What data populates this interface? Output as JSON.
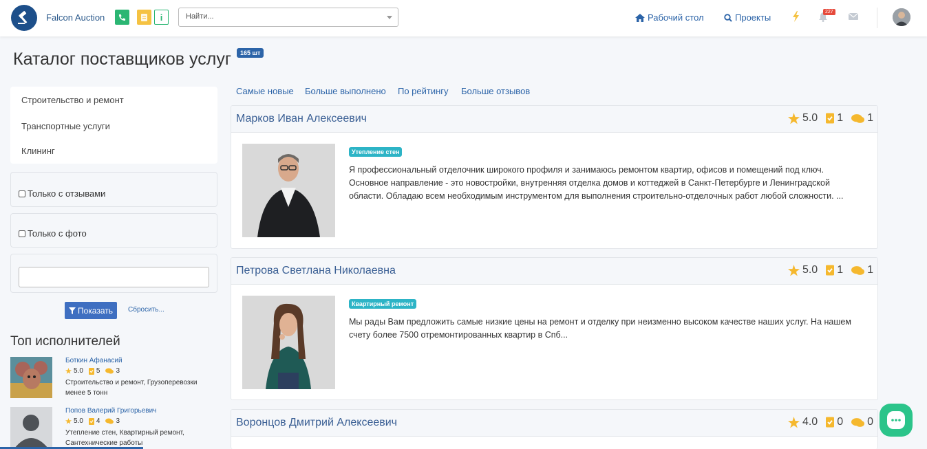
{
  "header": {
    "brand": "Falcon Auction",
    "search_placeholder": "Найти...",
    "nav": {
      "desktop": "Рабочий стол",
      "projects": "Проекты"
    },
    "notifications_count": "227",
    "colors": {
      "primary": "#2c64a8",
      "phone": "#2bb673",
      "note": "#f5c242"
    }
  },
  "page": {
    "title": "Каталог поставщиков услуг",
    "count_badge": "165 шт"
  },
  "sidebar": {
    "categories": [
      "Строительство и ремонт",
      "Транспортные услуги",
      "Клининг"
    ],
    "filter_reviews": "Только с отзывами",
    "filter_photo": "Только с фото",
    "show_button": "Показать",
    "reset_link": "Сбросить...",
    "top_title": "Топ исполнителей",
    "top": [
      {
        "name": "Боткин Афанасий",
        "rating": "5.0",
        "done": "5",
        "reviews": "3",
        "spec": "Строительство и ремонт, Грузоперевозки менее 5 тонн"
      },
      {
        "name": "Попов Валерий Григорьевич",
        "rating": "5.0",
        "done": "4",
        "reviews": "3",
        "spec": "Утепление стен, Квартирный ремонт, Сантехнические работы"
      }
    ]
  },
  "sort": [
    "Самые новые",
    "Больше выполнено",
    "По рейтингу",
    "Больше отзывов"
  ],
  "cards": [
    {
      "name": "Марков Иван Алексеевич",
      "rating": "5.0",
      "done": "1",
      "reviews": "1",
      "tag": "Утепление стен",
      "desc": "Я профессиональный отделочник широкого профиля и занимаюсь ремонтом квартир, офисов и помещений под ключ. Основное направление - это новостройки, внутренняя отделка домов и коттеджей в Санкт-Петербурге и Ленинградской области. Обладаю всем необходимым инструментом для выполнения строительно-отделочных работ любой сложности. ..."
    },
    {
      "name": "Петрова Светлана Николаевна",
      "rating": "5.0",
      "done": "1",
      "reviews": "1",
      "tag": "Квартирный ремонт",
      "desc": "Мы рады Вам предложить самые низкие цены на ремонт и отделку при неизменно высоком качестве наших услуг. На нашем счету более 7500 отремонтированных квартир в Спб..."
    },
    {
      "name": "Воронцов Дмитрий Алексеевич",
      "rating": "4.0",
      "done": "0",
      "reviews": "0"
    }
  ]
}
